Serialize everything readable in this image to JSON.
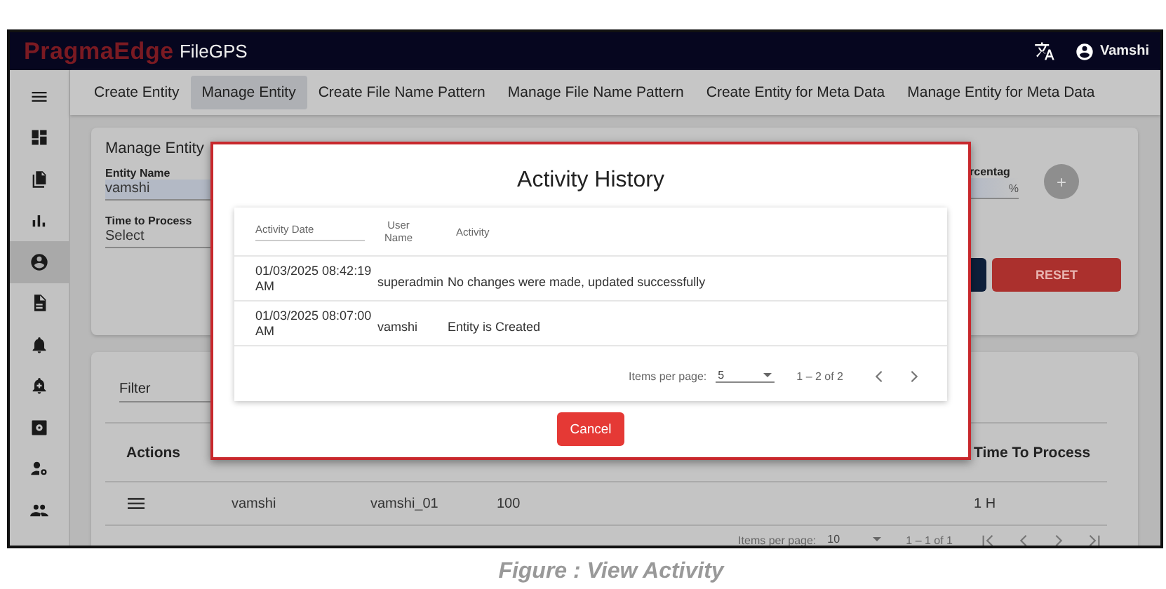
{
  "header": {
    "brand": "PragmaEdge",
    "product": "FileGPS",
    "user": "Vamshi"
  },
  "sidebar": {
    "items": [
      {
        "kind": "menu",
        "selected": false
      },
      {
        "kind": "dashboard",
        "selected": false
      },
      {
        "kind": "files",
        "selected": false
      },
      {
        "kind": "chart",
        "selected": false
      },
      {
        "kind": "account",
        "selected": true
      },
      {
        "kind": "file",
        "selected": false
      },
      {
        "kind": "bell",
        "selected": false
      },
      {
        "kind": "bell-plus",
        "selected": false
      },
      {
        "kind": "settings-box",
        "selected": false
      },
      {
        "kind": "user-gear",
        "selected": false
      },
      {
        "kind": "group",
        "selected": false
      }
    ]
  },
  "tabs": [
    {
      "label": "Create Entity",
      "selected": false
    },
    {
      "label": "Manage Entity",
      "selected": true
    },
    {
      "label": "Create File Name Pattern",
      "selected": false
    },
    {
      "label": "Manage File Name Pattern",
      "selected": false
    },
    {
      "label": "Create Entity for Meta Data",
      "selected": false
    },
    {
      "label": "Manage Entity for Meta Data",
      "selected": false
    }
  ],
  "form": {
    "title": "Manage Entity",
    "fields": [
      {
        "label": "Entity Name",
        "value": "vamshi",
        "filled": true
      },
      {
        "label": "Time to Process",
        "value": "Select",
        "filled": false
      }
    ],
    "percentage": {
      "label": "rcentag",
      "suffix": "%"
    },
    "add_button": "+",
    "reset_button": "RESET"
  },
  "table": {
    "filter": "Filter",
    "columns": [
      "Actions",
      "",
      "",
      "",
      "Time To Process"
    ],
    "rows": [
      {
        "cells": [
          "",
          "vamshi",
          "vamshi_01",
          "100",
          "1 H"
        ]
      }
    ],
    "paginator": {
      "label": "Items per page:",
      "size": "10",
      "range": "1 – 1 of 1"
    }
  },
  "dialog": {
    "title": "Activity History",
    "columns": [
      "Activity Date",
      "User Name",
      "Activity"
    ],
    "rows": [
      {
        "cells": [
          "01/03/2025 08:42:19 AM",
          "superadmin",
          "No changes were made, updated successfully"
        ]
      },
      {
        "cells": [
          "01/03/2025 08:07:00 AM",
          "vamshi",
          "Entity is Created"
        ]
      }
    ],
    "paginator": {
      "label": "Items per page:",
      "size": "5",
      "range": "1 – 2 of 2"
    },
    "cancel": "Cancel"
  },
  "caption": "Figure : View Activity"
}
